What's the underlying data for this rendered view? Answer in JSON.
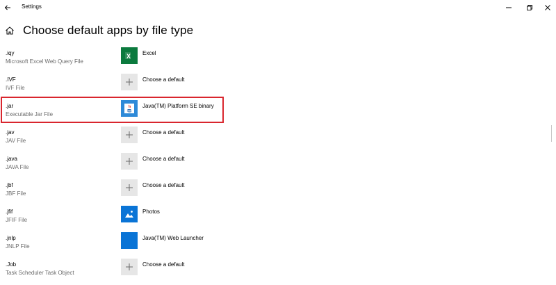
{
  "window": {
    "title": "Settings",
    "back_icon": "back-arrow-icon",
    "controls": [
      "minimize-icon",
      "restore-icon",
      "close-icon"
    ]
  },
  "header": {
    "home_icon": "home-icon",
    "title": "Choose default apps by file type"
  },
  "rows": [
    {
      "ext": ".iqy",
      "desc": "Microsoft Excel Web Query File",
      "app": "Excel",
      "icon": "excel-icon"
    },
    {
      "ext": ".IVF",
      "desc": "IVF File",
      "app": "Choose a default",
      "icon": "plus-icon"
    },
    {
      "ext": ".jar",
      "desc": "Executable Jar File",
      "app": "Java(TM) Platform SE binary",
      "icon": "java-icon",
      "highlighted": true
    },
    {
      "ext": ".jav",
      "desc": "JAV File",
      "app": "Choose a default",
      "icon": "plus-icon"
    },
    {
      "ext": ".java",
      "desc": "JAVA File",
      "app": "Choose a default",
      "icon": "plus-icon"
    },
    {
      "ext": ".jbf",
      "desc": "JBF File",
      "app": "Choose a default",
      "icon": "plus-icon"
    },
    {
      "ext": ".jfif",
      "desc": "JFIF File",
      "app": "Photos",
      "icon": "photos-icon"
    },
    {
      "ext": ".jnlp",
      "desc": "JNLP File",
      "app": "Java(TM) Web Launcher",
      "icon": "java-web-launcher-icon"
    },
    {
      "ext": ".Job",
      "desc": "Task Scheduler Task Object",
      "app": "Choose a default",
      "icon": "plus-icon"
    }
  ],
  "colors": {
    "highlight": "#d9262e",
    "excel": "#0b7a3e",
    "accent": "#0a74d6",
    "plus_tile": "#e6e6e6"
  }
}
